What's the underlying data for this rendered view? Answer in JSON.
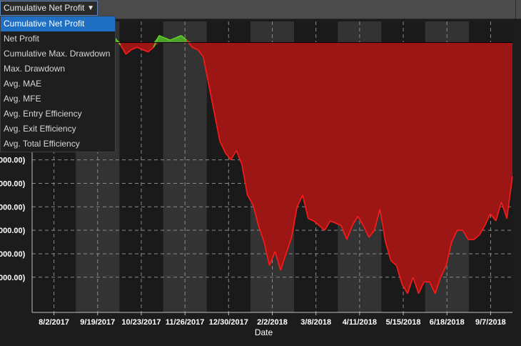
{
  "toolbar": {
    "selected_label": "Cumulative Net Profit",
    "arrow_icon": "chevron-down-icon"
  },
  "dropdown": {
    "items": [
      {
        "label": "Cumulative Net Profit",
        "selected": true
      },
      {
        "label": "Net Profit",
        "selected": false
      },
      {
        "label": "Cumulative Max. Drawdown",
        "selected": false
      },
      {
        "label": "Max. Drawdown",
        "selected": false
      },
      {
        "label": "Avg. MAE",
        "selected": false
      },
      {
        "label": "Avg. MFE",
        "selected": false
      },
      {
        "label": "Avg. Entry Efficiency",
        "selected": false
      },
      {
        "label": "Avg. Exit Efficiency",
        "selected": false
      },
      {
        "label": "Avg. Total Efficiency",
        "selected": false
      }
    ]
  },
  "chart_data": {
    "type": "area",
    "title": "",
    "xlabel": "Date",
    "ylabel": "",
    "x_tick_labels": [
      "8/2/2017",
      "9/19/2017",
      "10/23/2017",
      "11/26/2017",
      "12/30/2017",
      "2/2/2018",
      "3/8/2018",
      "4/11/2018",
      "5/15/2018",
      "6/18/2018",
      "9/7/2018"
    ],
    "y_tick_labels": [
      "000.00)",
      "000.00)",
      "000.00)",
      "000.00)",
      "000.00)",
      "000.00)"
    ],
    "y_tick_values": [
      -5,
      -6,
      -7,
      -8,
      -9,
      -10
    ],
    "ylim": [
      -11.5,
      0.9
    ],
    "baseline": 0,
    "positive_color": "#5fcf2a",
    "positive_fill": "#4ea32a",
    "negative_color": "#ff1a1a",
    "negative_fill": "#9d1616",
    "grid": true,
    "values": [
      -1.6,
      -1.2,
      -0.8,
      -0.5,
      -0.3,
      -0.1,
      0.1,
      0.3,
      0.5,
      0.6,
      0.6,
      0.5,
      0.4,
      0.3,
      0.2,
      0.2,
      -0.1,
      -0.5,
      -0.3,
      -0.2,
      -0.3,
      -0.4,
      -0.2,
      0.3,
      0.2,
      0.1,
      0.2,
      0.3,
      0.1,
      -0.2,
      -0.3,
      -0.6,
      -1.8,
      -3.0,
      -4.2,
      -4.7,
      -5.0,
      -4.6,
      -5.2,
      -6.5,
      -6.9,
      -7.8,
      -8.5,
      -9.5,
      -8.9,
      -9.7,
      -9.0,
      -8.3,
      -7.0,
      -6.5,
      -7.5,
      -7.6,
      -7.8,
      -8.0,
      -7.6,
      -7.7,
      -7.8,
      -8.4,
      -7.8,
      -7.4,
      -7.8,
      -8.3,
      -8.0,
      -7.1,
      -8.5,
      -9.3,
      -9.5,
      -10.3,
      -10.7,
      -10.0,
      -10.7,
      -10.2,
      -10.2,
      -10.7,
      -10.0,
      -9.5,
      -8.5,
      -8.0,
      -8.0,
      -8.4,
      -8.4,
      -8.2,
      -7.8,
      -7.3,
      -7.6,
      -6.8,
      -7.5,
      -5.7
    ]
  },
  "background": {
    "page": "#1c1c1c",
    "band_light": "#333333",
    "band_dark": "#1a1a1a"
  }
}
